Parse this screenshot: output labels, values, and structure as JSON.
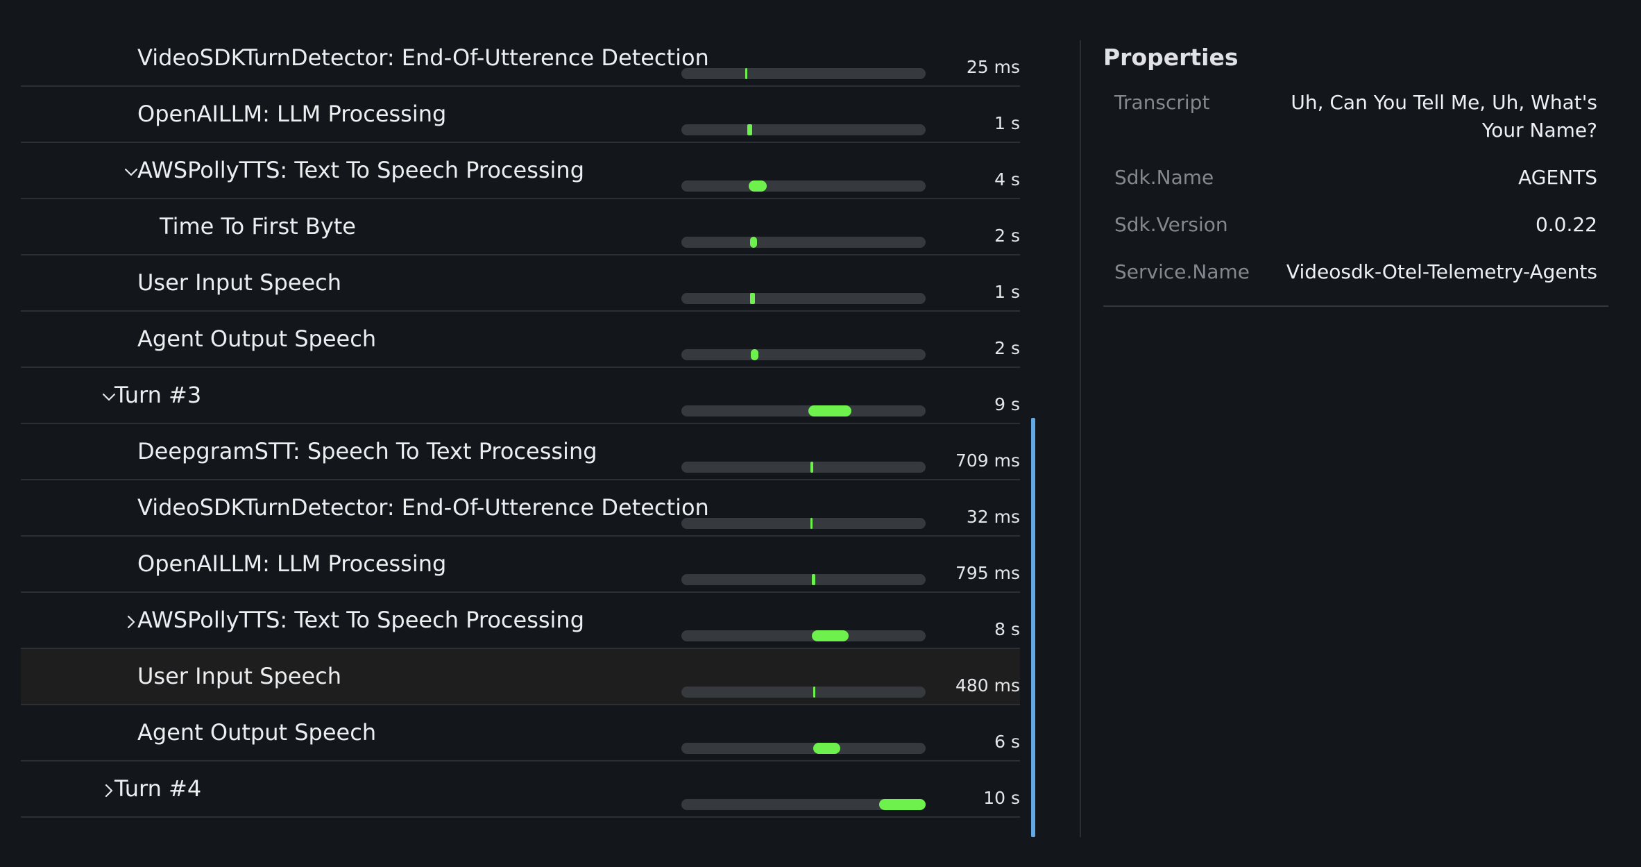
{
  "colors": {
    "background": "#13171c",
    "track": "#36393d",
    "bar_fill": "#6ef04d",
    "scroll_indicator": "#62a8e5",
    "selected_row": "#1e1e1f"
  },
  "trace": {
    "spans": [
      {
        "label": "VideoSDKTurnDetector: End-Of-Utterence Detection",
        "duration": "25 ms",
        "depth": 2,
        "chevron": "none",
        "bar_start": 0.26,
        "bar_width": 0.006
      },
      {
        "label": "OpenAILLM: LLM Processing",
        "duration": "1 s",
        "depth": 2,
        "chevron": "none",
        "bar_start": 0.27,
        "bar_width": 0.02
      },
      {
        "label": "AWSPollyTTS: Text To Speech Processing",
        "duration": "4 s",
        "depth": 2,
        "chevron": "down",
        "bar_start": 0.275,
        "bar_width": 0.075
      },
      {
        "label": "Time To First Byte",
        "duration": "2 s",
        "depth": 3,
        "chevron": "none",
        "bar_start": 0.28,
        "bar_width": 0.03
      },
      {
        "label": "User Input Speech",
        "duration": "1 s",
        "depth": 2,
        "chevron": "none",
        "bar_start": 0.28,
        "bar_width": 0.02
      },
      {
        "label": "Agent Output Speech",
        "duration": "2 s",
        "depth": 2,
        "chevron": "none",
        "bar_start": 0.285,
        "bar_width": 0.03
      },
      {
        "label": "Turn #3",
        "duration": "9 s",
        "depth": 1,
        "chevron": "down",
        "bar_start": 0.52,
        "bar_width": 0.175
      },
      {
        "label": "DeepgramSTT: Speech To Text Processing",
        "duration": "709 ms",
        "depth": 2,
        "chevron": "none",
        "bar_start": 0.527,
        "bar_width": 0.012
      },
      {
        "label": "VideoSDKTurnDetector: End-Of-Utterence Detection",
        "duration": "32 ms",
        "depth": 2,
        "chevron": "none",
        "bar_start": 0.528,
        "bar_width": 0.006
      },
      {
        "label": "OpenAILLM: LLM Processing",
        "duration": "795 ms",
        "depth": 2,
        "chevron": "none",
        "bar_start": 0.533,
        "bar_width": 0.014
      },
      {
        "label": "AWSPollyTTS: Text To Speech Processing",
        "duration": "8 s",
        "depth": 2,
        "chevron": "right",
        "bar_start": 0.535,
        "bar_width": 0.15
      },
      {
        "label": "User Input Speech",
        "duration": "480 ms",
        "depth": 2,
        "chevron": "none",
        "bar_start": 0.54,
        "bar_width": 0.008,
        "selected": true
      },
      {
        "label": "Agent Output Speech",
        "duration": "6 s",
        "depth": 2,
        "chevron": "none",
        "bar_start": 0.54,
        "bar_width": 0.11
      },
      {
        "label": "Turn #4",
        "duration": "10 s",
        "depth": 1,
        "chevron": "right",
        "bar_start": 0.81,
        "bar_width": 0.19
      }
    ]
  },
  "properties": {
    "title": "Properties",
    "items": [
      {
        "key": "Transcript",
        "value": "Uh, Can You Tell Me, Uh, What's Your Name?"
      },
      {
        "key": "Sdk.Name",
        "value": "AGENTS"
      },
      {
        "key": "Sdk.Version",
        "value": "0.0.22"
      },
      {
        "key": "Service.Name",
        "value": "Videosdk-Otel-Telemetry-Agents"
      }
    ]
  }
}
